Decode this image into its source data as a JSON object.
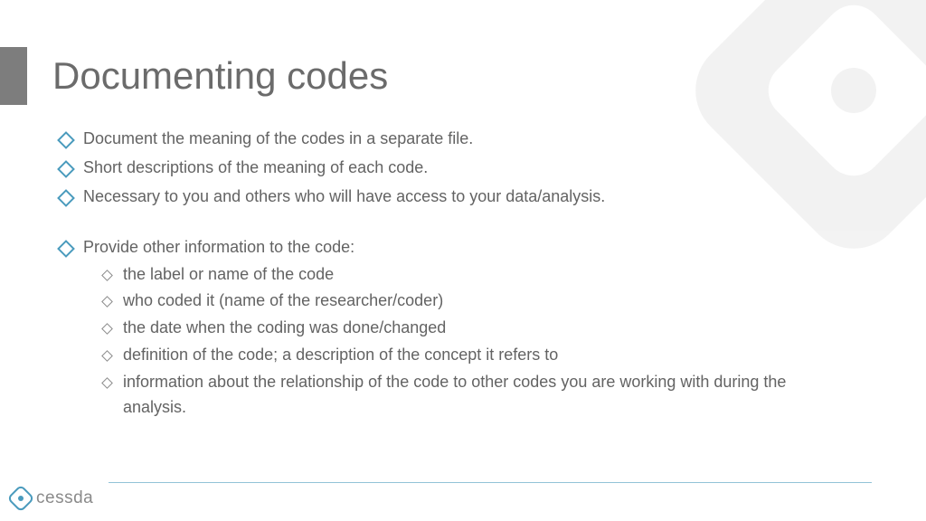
{
  "title": "Documenting codes",
  "bullets": [
    "Document the meaning of the codes in a separate file.",
    "Short descriptions of the meaning of each code.",
    "Necessary to you and others who will have access to your data/analysis."
  ],
  "bullet_with_sub": {
    "text": "Provide other information to the code:",
    "subs": [
      "the label or name of the code",
      "who coded it (name of the researcher/coder)",
      "the date when the coding was done/changed",
      "definition of the code; a description of the concept it refers to",
      "information about the relationship of the code to other codes you are working with during the analysis."
    ]
  },
  "footer": {
    "brand": "cessda"
  }
}
